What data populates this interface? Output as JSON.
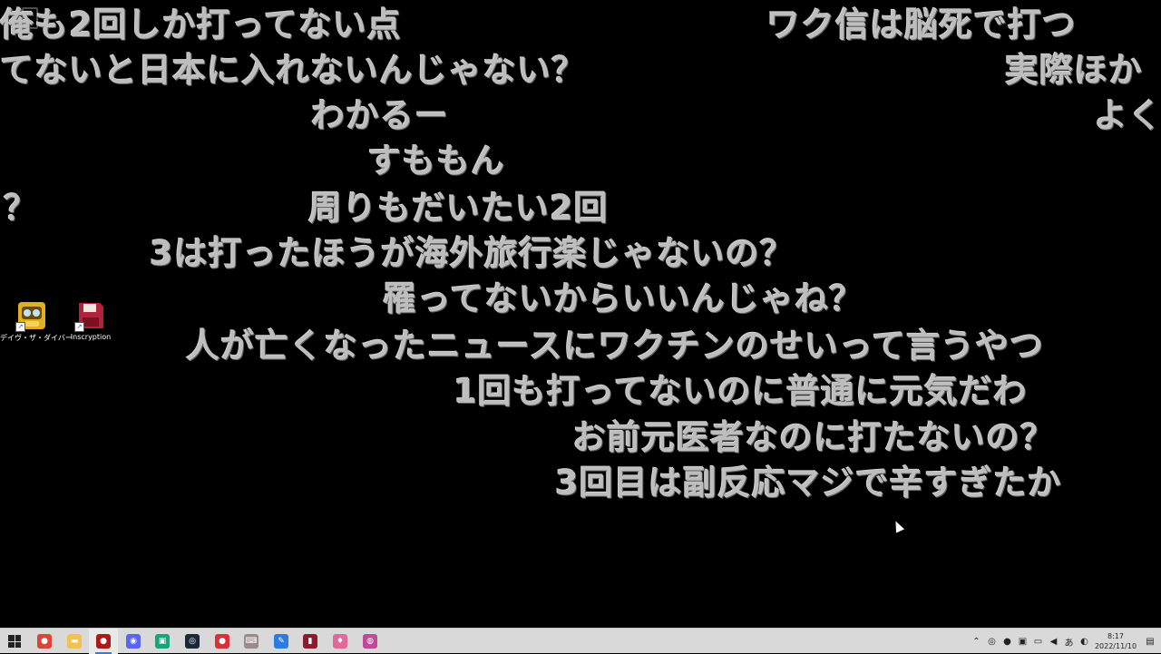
{
  "comments": [
    {
      "text": "俺も2回しか打ってない点"
    },
    {
      "text": "ワク信は脳死で打つ"
    },
    {
      "text": "てないと日本に入れないんじゃない？"
    },
    {
      "text": "実際ほか"
    },
    {
      "text": "わかるー"
    },
    {
      "text": "よく"
    },
    {
      "text": "すももん"
    },
    {
      "text": "？"
    },
    {
      "text": "周りもだいたい2回"
    },
    {
      "text": "3は打ったほうが海外旅行楽じゃないの？"
    },
    {
      "text": "罹ってないからいいんじゃね？"
    },
    {
      "text": "人が亡くなったニュースにワクチンのせいって言うやつ"
    },
    {
      "text": "1回も打ってないのに普通に元気だわ"
    },
    {
      "text": "お前元医者なのに打たないの？"
    },
    {
      "text": "3回目は副反応マジで辛すぎたか"
    }
  ],
  "desktop_icons": [
    {
      "label": "デイヴ・ザ・ダイバー",
      "icon": "dave-the-diver-icon",
      "color": "#e0b020"
    },
    {
      "label": "Inscryption",
      "icon": "inscryption-icon",
      "color": "#b0233a"
    }
  ],
  "taskbar": {
    "apps": [
      {
        "name": "chrome",
        "icon": "chrome-icon",
        "color": "#db4437",
        "glyph": "●"
      },
      {
        "name": "file-explorer",
        "icon": "folder-icon",
        "color": "#f2c14e",
        "glyph": "▬"
      },
      {
        "name": "app-red-black",
        "icon": "app-icon",
        "color": "#b01818",
        "glyph": "●",
        "active": true
      },
      {
        "name": "discord",
        "icon": "discord-icon",
        "color": "#5865f2",
        "glyph": "◉"
      },
      {
        "name": "app-green",
        "icon": "green-app-icon",
        "color": "#1aa37a",
        "glyph": "▣"
      },
      {
        "name": "steam",
        "icon": "steam-icon",
        "color": "#1b2838",
        "glyph": "◎"
      },
      {
        "name": "app-red",
        "icon": "red-app-icon",
        "color": "#d9303a",
        "glyph": "●"
      },
      {
        "name": "keyboard",
        "icon": "keyboard-icon",
        "color": "#9a8a8a",
        "glyph": "⌨"
      },
      {
        "name": "app-blue",
        "icon": "blue-app-icon",
        "color": "#2b7be0",
        "glyph": "✎"
      },
      {
        "name": "inscryption",
        "icon": "inscryption-taskbar-icon",
        "color": "#8a1c2c",
        "glyph": "▮"
      },
      {
        "name": "app-flame",
        "icon": "flame-icon",
        "color": "#e06a9a",
        "glyph": "♦"
      },
      {
        "name": "app-multi",
        "icon": "multicolor-app-icon",
        "color": "#c04a9a",
        "glyph": "◍"
      }
    ],
    "tray": {
      "icons": [
        "chevron-up-icon",
        "meet-icon",
        "mic-icon",
        "network-icon",
        "screen-icon",
        "volume-icon",
        "ime-icon",
        "shield-icon"
      ],
      "ime_text": "あ",
      "time": "8:17",
      "date": "2022/11/10"
    }
  }
}
